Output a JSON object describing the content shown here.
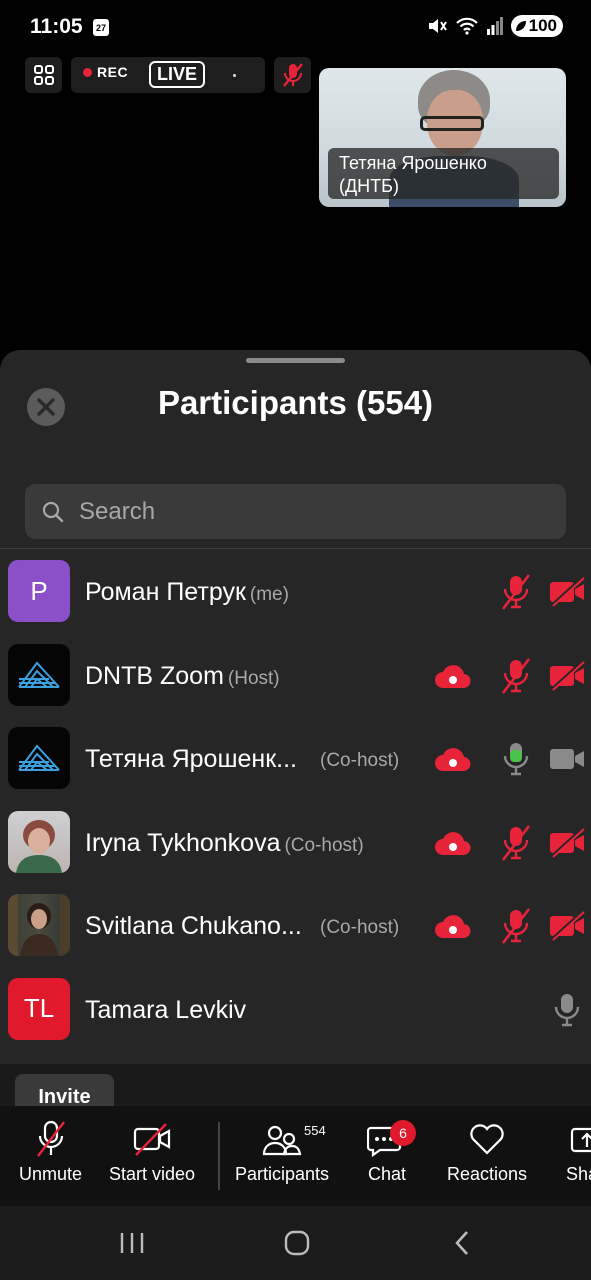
{
  "status_bar": {
    "time": "11:05",
    "calendar_day": "27",
    "battery": "100"
  },
  "meeting": {
    "rec_label": "REC",
    "live_label": "LIVE",
    "video_tile": {
      "name_line1": "Тетяна Ярошенко",
      "name_line2": "(ДНТБ)"
    }
  },
  "participants_panel": {
    "title": "Participants (554)",
    "search_placeholder": "Search",
    "rows": [
      {
        "name": "Роман Петрук",
        "role": "(me)",
        "avatar_text": "P",
        "avatar_color": "#8b4fc8",
        "recording": false,
        "mic": "muted",
        "camera": "off"
      },
      {
        "name": "DNTB Zoom",
        "role": "(Host)",
        "avatar_text": "",
        "recording": true,
        "mic": "muted",
        "camera": "off"
      },
      {
        "name": "Тетяна Ярошенк...",
        "role": "(Co-host)",
        "avatar_text": "",
        "recording": true,
        "mic": "active",
        "camera": "on"
      },
      {
        "name": "Iryna Tykhonkova",
        "role": "(Co-host)",
        "avatar_text": "",
        "recording": true,
        "mic": "muted",
        "camera": "off"
      },
      {
        "name": "Svitlana Chukano...",
        "role": "(Co-host)",
        "avatar_text": "",
        "recording": true,
        "mic": "muted",
        "camera": "off"
      },
      {
        "name": "Tamara Levkiv",
        "role": "",
        "avatar_text": "TL",
        "avatar_color": "#e0192d",
        "recording": false,
        "mic": "unmuted",
        "camera": "none"
      }
    ],
    "invite_label": "Invite"
  },
  "toolbar": {
    "unmute_label": "Unmute",
    "start_video_label": "Start video",
    "participants_label": "Participants",
    "participants_count": "554",
    "chat_label": "Chat",
    "chat_badge": "6",
    "reactions_label": "Reactions",
    "share_label": "Sha"
  },
  "colors": {
    "muted_red": "#e8243a",
    "active_mic_green": "#4cc24c",
    "sheet_bg": "#262626"
  }
}
